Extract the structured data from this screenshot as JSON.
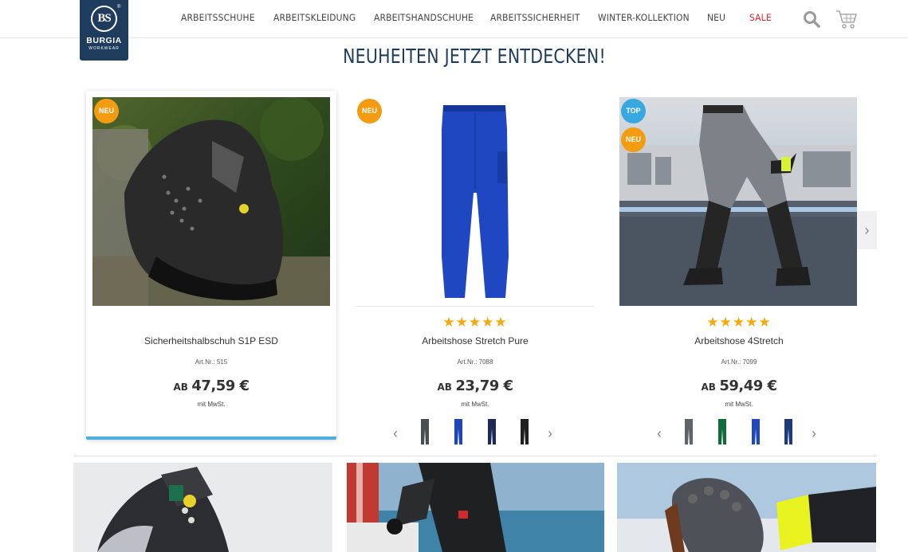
{
  "brand": {
    "mark": "BS",
    "name": "BURGIA",
    "sub": "WORKWEAR"
  },
  "nav": {
    "items": [
      "ARBEITSSCHUHE",
      "ARBEITSKLEIDUNG",
      "ARBEITSHANDSCHUHE",
      "ARBEITSSICHERHEIT",
      "WINTER-KOLLEKTION",
      "NEU"
    ],
    "sale": "SALE"
  },
  "section_title": "NEUHEITEN JETZT ENTDECKEN!",
  "products": [
    {
      "name": "Sicherheitshalbschuh S1P ESD",
      "artnr": "Art.Nr.: 515",
      "ab": "AB",
      "price": "47,59 €",
      "vat": "mit MwSt.",
      "badges": [
        "NEU"
      ],
      "rating": "★★★★★",
      "swatch_colors": []
    },
    {
      "name": "Arbeitshose Stretch Pure",
      "artnr": "Art.Nr.: 7088",
      "ab": "AB",
      "price": "23,79 €",
      "vat": "mit MwSt.",
      "badges": [
        "NEU"
      ],
      "rating": "★★★★★",
      "swatch_colors": [
        "#4a4d52",
        "#1f44b8",
        "#1c2a55",
        "#202020"
      ]
    },
    {
      "name": "Arbeitshose 4Stretch",
      "artnr": "Art.Nr.: 7099",
      "ab": "AB",
      "price": "59,49 €",
      "vat": "mit MwSt.",
      "badges": [
        "TOP",
        "NEU"
      ],
      "rating": "★★★★★",
      "swatch_colors": [
        "#5f6266",
        "#0f6b37",
        "#1f48c0",
        "#1e3a78"
      ]
    }
  ],
  "icons": {
    "search": "search-icon",
    "cart": "cart-icon",
    "prev": "chevron-left-icon",
    "next": "chevron-right-icon"
  },
  "colors": {
    "navy": "#1d3c5e",
    "sale": "#e3262b",
    "badge_neu": "#f39c12",
    "badge_top": "#38a9e0",
    "star": "#f5a90a",
    "active_bar": "#4ab0de"
  }
}
